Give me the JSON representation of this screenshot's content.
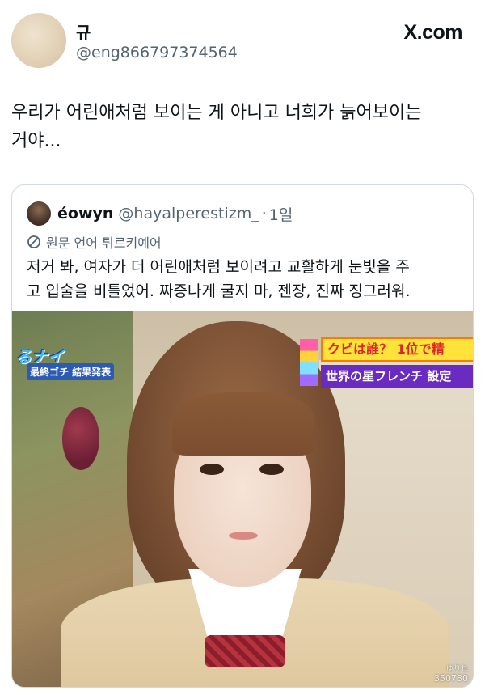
{
  "header": {
    "display_name": "규",
    "handle": "@eng866797374564",
    "brand": "X.com"
  },
  "tweet": {
    "text_line1": "우리가 어린애처럼 보이는 게 아니고 너희가 늙어보이는",
    "text_line2": "거야..."
  },
  "quote": {
    "display_name": "éowyn",
    "handle": "@hayalperestizm_",
    "separator": "·",
    "time": "1일",
    "translation_label": "원문 언어 튀르키예어",
    "text_line1": "저거 봐, 여자가 더 어린애처럼 보이려고 교활하게 눈빛을 주",
    "text_line2": "고 입술을 비틀었어. 짜증나게 굴지 마, 젠장, 진짜 징그러워.",
    "photo": {
      "caption_left_top": "るナイ",
      "caption_left_bottom": "最終ゴチ 結果発表",
      "caption_right_top": "クビは誰？ 1位で精",
      "caption_right_bottom": "世界の星フレンチ 設定",
      "watermark_small": "ゆりれ",
      "watermark_id": "350730"
    }
  },
  "colors": {
    "text_primary": "#0f1419",
    "text_secondary": "#536471",
    "border": "#cfd9de"
  }
}
